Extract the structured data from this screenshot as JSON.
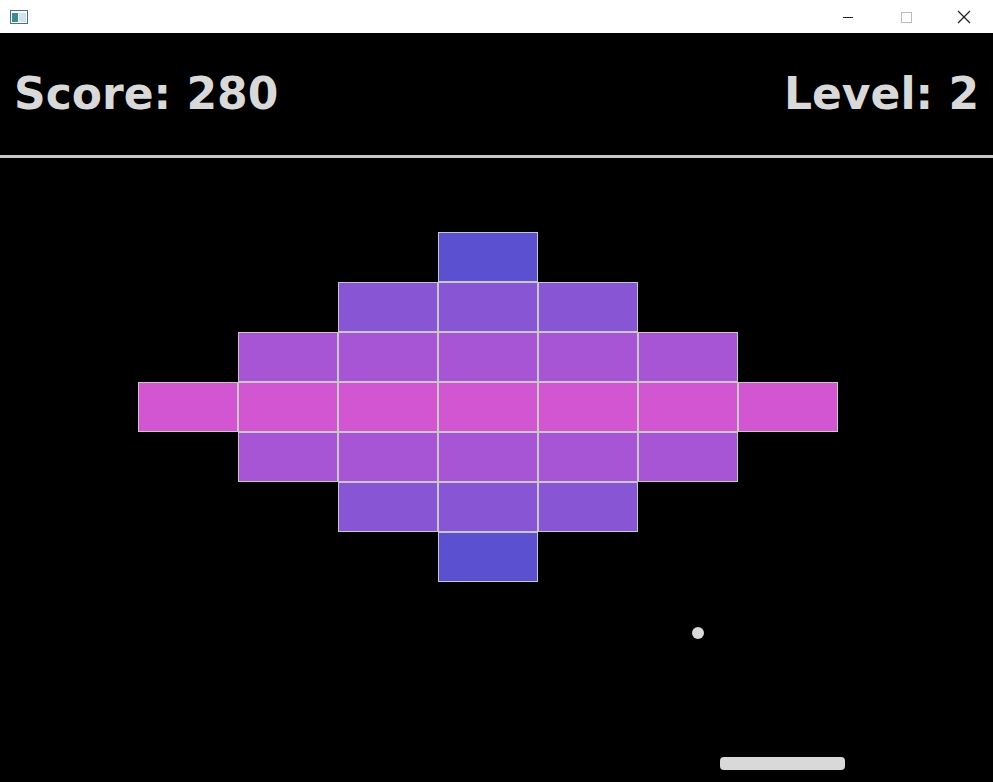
{
  "hud": {
    "score": "Score: 280",
    "level": "Level: 2"
  },
  "bricks": {
    "rows": [
      {
        "color": "#5b50d0",
        "cells": [
          false,
          false,
          false,
          true,
          false,
          false,
          false
        ]
      },
      {
        "color": "#8855d5",
        "cells": [
          false,
          false,
          true,
          true,
          true,
          false,
          false
        ]
      },
      {
        "color": "#a855d5",
        "cells": [
          false,
          true,
          true,
          true,
          true,
          true,
          false
        ]
      },
      {
        "color": "#d255d2",
        "cells": [
          true,
          true,
          true,
          true,
          true,
          true,
          true
        ]
      },
      {
        "color": "#a855d5",
        "cells": [
          false,
          true,
          true,
          true,
          true,
          true,
          false
        ]
      },
      {
        "color": "#8855d5",
        "cells": [
          false,
          false,
          true,
          true,
          true,
          false,
          false
        ]
      },
      {
        "color": "#5b50d0",
        "cells": [
          false,
          false,
          false,
          true,
          false,
          false,
          false
        ]
      }
    ]
  }
}
